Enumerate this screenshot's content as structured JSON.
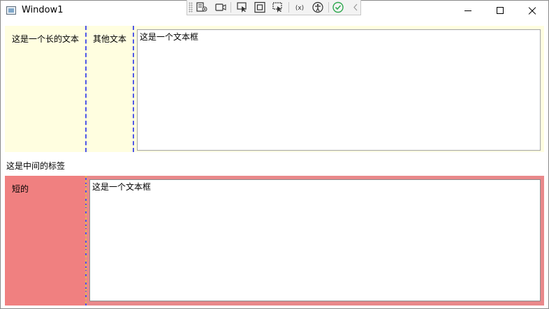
{
  "window": {
    "title": "Window1",
    "icons": {
      "app": "window-app-icon",
      "minimize": "minimize-icon",
      "maximize": "maximize-icon",
      "close": "close-icon"
    }
  },
  "debug_toolbar": {
    "tools": [
      "live-visual-tree-icon",
      "track-focused-element-icon",
      "select-element-icon",
      "display-layout-adorners-icon",
      "track-selection-icon",
      "binding-failures-icon",
      "accessibility-checker-icon",
      "hot-reload-ok-icon",
      "collapse-icon"
    ]
  },
  "top_grid": {
    "long_label": "这是一个长的文本",
    "other_label": "其他文本",
    "textbox_value": "这是一个文本框",
    "background": "#fffee0"
  },
  "middle_label": "这是中间的标签",
  "bottom_grid": {
    "short_label": "短的",
    "textbox_value": "这是一个文本框",
    "background": "#f08080"
  }
}
